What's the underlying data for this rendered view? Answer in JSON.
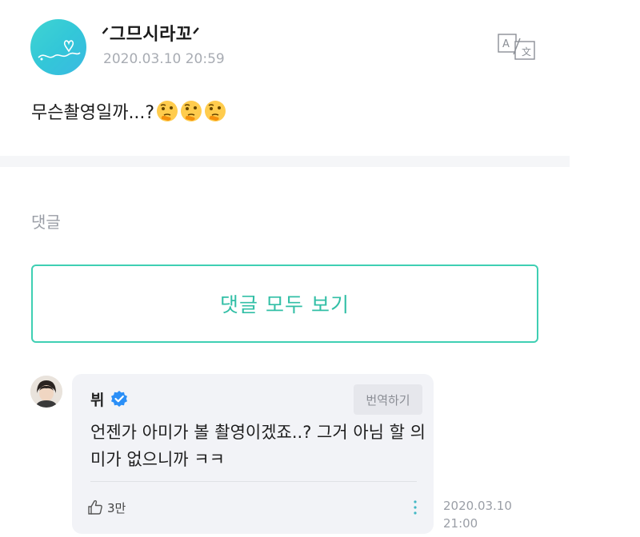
{
  "post": {
    "author": "ᐟ그므시라꼬ᐟ",
    "date": "2020.03.10 20:59",
    "text": "무슨촬영일까...?",
    "emoji_icon": "thinking-face-icon",
    "emoji_count": 3
  },
  "comments_section": {
    "label": "댓글",
    "view_all_label": "댓글 모두 보기"
  },
  "comment": {
    "author": "뷔",
    "verified_icon": "verified-badge-icon",
    "translate_label": "번역하기",
    "text": "언젠가 아미가 볼 촬영이겠죠..? 그거 아님 할 의미가 없으니까 ㅋㅋ",
    "likes": "3만",
    "date_line1": "2020.03.10",
    "date_line2": "21:00"
  },
  "colors": {
    "accent": "#3fcfb3",
    "bubble": "#f2f3f7",
    "muted_text": "#9a9ea6"
  }
}
